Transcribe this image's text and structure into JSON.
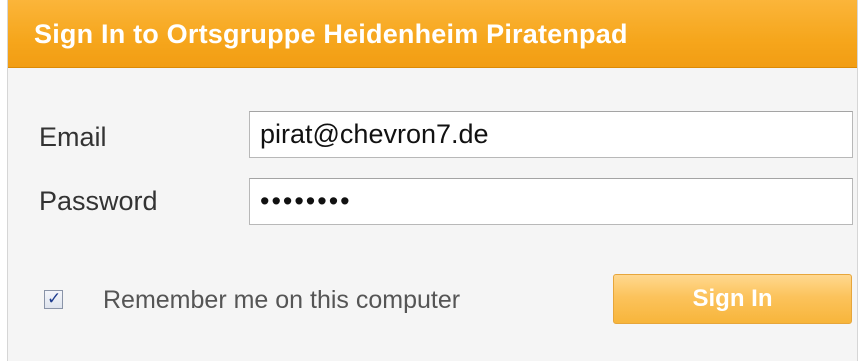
{
  "header": {
    "title": "Sign In to Ortsgruppe Heidenheim Piratenpad"
  },
  "form": {
    "email_label": "Email",
    "email_value": "pirat@chevron7.de",
    "password_label": "Password",
    "password_value": "••••••••",
    "remember_label": "Remember me on this computer",
    "remember_checked": true,
    "submit_label": "Sign In"
  },
  "colors": {
    "header_orange": "#f6a61c",
    "button_orange": "#fcc35c",
    "background": "#f5f5f5"
  },
  "icons": {
    "checkbox": "checkmark-icon"
  }
}
